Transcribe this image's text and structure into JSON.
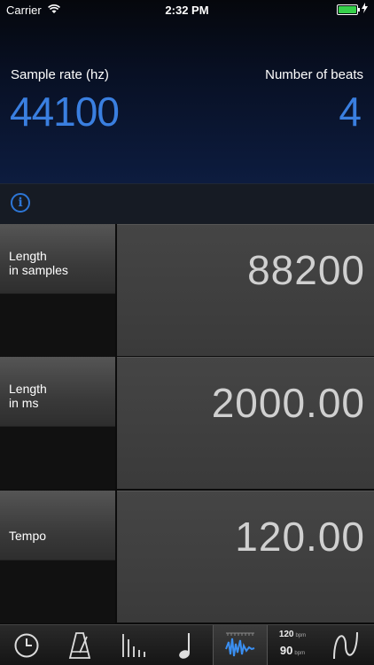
{
  "status": {
    "carrier": "Carrier",
    "time": "2:32 PM",
    "battery_level": 1.0
  },
  "header": {
    "sample_rate_label": "Sample rate (hz)",
    "sample_rate_value": "44100",
    "beats_label": "Number of beats",
    "beats_value": "4"
  },
  "info": {
    "glyph": "i"
  },
  "rows": [
    {
      "label": "Length\nin samples",
      "value": "88200"
    },
    {
      "label": "Length\nin ms",
      "value": "2000.00"
    },
    {
      "label": "Tempo",
      "value": "120.00"
    }
  ],
  "tabs": [
    {
      "icon": "clock-icon"
    },
    {
      "icon": "metronome-icon"
    },
    {
      "icon": "bars-icon"
    },
    {
      "icon": "note-icon"
    },
    {
      "icon": "waveform-icon",
      "active": true
    },
    {
      "icon": "bpm-icon",
      "bpm_top": "120",
      "bpm_bottom": "90",
      "unit": "bpm"
    },
    {
      "icon": "curve-icon"
    }
  ],
  "colors": {
    "accent": "#3a7fe0",
    "header_bg": "#0d1c3f"
  }
}
